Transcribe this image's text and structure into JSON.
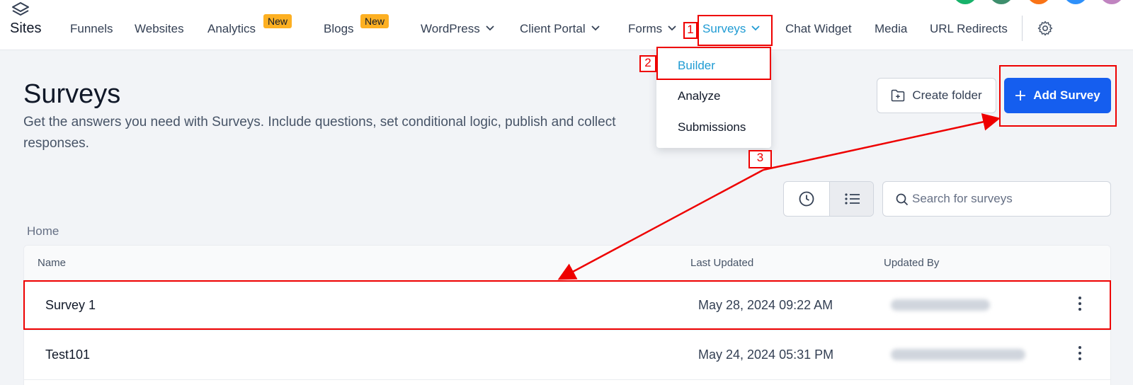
{
  "app": {
    "brand_label": "Sites"
  },
  "nav": {
    "items": [
      "Funnels",
      "Websites",
      "Analytics",
      "Blogs",
      "WordPress",
      "Client Portal",
      "Forms",
      "Surveys",
      "Chat Widget",
      "Media",
      "URL Redirects"
    ],
    "new_badge": "New",
    "settings_icon": "gear-icon"
  },
  "dropdown": {
    "items": [
      "Builder",
      "Analyze",
      "Submissions"
    ],
    "active": "Builder"
  },
  "header": {
    "title": "Surveys",
    "description": "Get the answers you need with Surveys. Include questions, set conditional logic, publish and collect responses.",
    "create_folder_label": "Create folder",
    "add_survey_label": "Add Survey"
  },
  "search": {
    "placeholder": "Search for surveys"
  },
  "breadcrumb": "Home",
  "table": {
    "headers": {
      "name": "Name",
      "last_updated": "Last Updated",
      "updated_by": "Updated By"
    },
    "rows": [
      {
        "name": "Survey 1",
        "last_updated": "May 28, 2024 09:22 AM"
      },
      {
        "name": "Test101",
        "last_updated": "May 24, 2024 05:31 PM"
      }
    ]
  },
  "annotations": {
    "labels": [
      "1",
      "2",
      "3"
    ]
  },
  "colors": {
    "primary": "#155eef",
    "active_nav": "#1f9bd3",
    "badge": "#fdb022",
    "annotation": "#ee0000"
  }
}
